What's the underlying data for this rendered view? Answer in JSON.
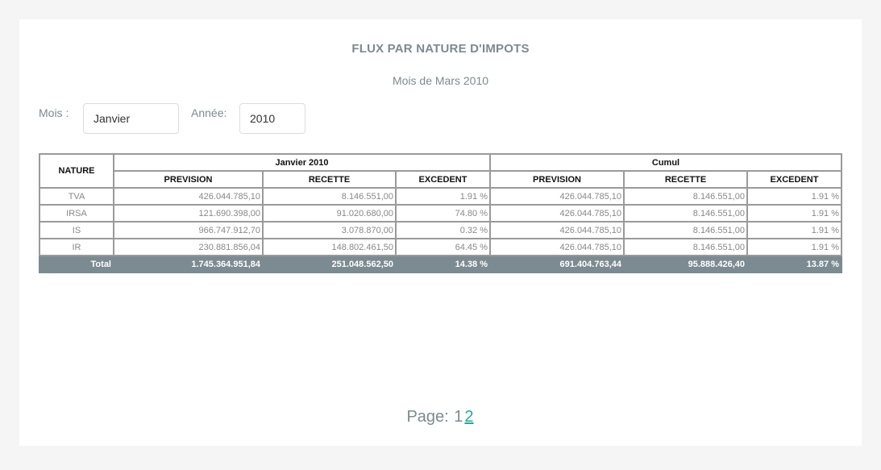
{
  "header": {
    "title": "FLUX PAR NATURE D'IMPOTS",
    "subtitle": "Mois de Mars 2010"
  },
  "filters": {
    "mois_label": "Mois :",
    "mois_value": "Janvier",
    "annee_label": "Année:",
    "annee_value": "2010"
  },
  "table": {
    "nature_header": "NATURE",
    "group1": "Janvier 2010",
    "group2": "Cumul",
    "cols": [
      "PREVISION",
      "RECETTE",
      "EXCEDENT",
      "PREVISION",
      "RECETTE",
      "EXCEDENT"
    ],
    "rows": [
      {
        "nature": "TVA",
        "cells": [
          "426.044.785,10",
          "8.146.551,00",
          "1.91 %",
          "426.044.785,10",
          "8.146.551,00",
          "1.91 %"
        ]
      },
      {
        "nature": "IRSA",
        "cells": [
          "121.690.398,00",
          "91.020.680,00",
          "74.80 %",
          "426.044.785,10",
          "8.146.551,00",
          "1.91 %"
        ]
      },
      {
        "nature": "IS",
        "cells": [
          "966.747.912,70",
          "3.078.870,00",
          "0.32 %",
          "426.044.785,10",
          "8.146.551,00",
          "1.91 %"
        ]
      },
      {
        "nature": "IR",
        "cells": [
          "230.881.856,04",
          "148.802.461,50",
          "64.45 %",
          "426.044.785,10",
          "8.146.551,00",
          "1.91 %"
        ]
      }
    ],
    "total": {
      "label": "Total",
      "cells": [
        "1.745.364.951,84",
        "251.048.562,50",
        "14.38 %",
        "691.404.763,44",
        "95.888.426,40",
        "13.87 %"
      ]
    }
  },
  "pagination": {
    "label": "Page:",
    "pages": [
      "1",
      "2"
    ],
    "active": "2"
  }
}
